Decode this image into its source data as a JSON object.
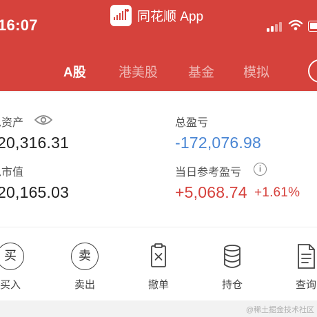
{
  "status_bar": {
    "time": "16:07"
  },
  "app": {
    "name": "同花顺 App"
  },
  "tabs": [
    {
      "label": "A股",
      "active": true
    },
    {
      "label": "港美股",
      "active": false
    },
    {
      "label": "基金",
      "active": false
    },
    {
      "label": "模拟",
      "active": false
    }
  ],
  "account": {
    "total_assets_label": "总资产",
    "total_assets_value": "20,316.31",
    "total_pnl_label": "总盈亏",
    "total_pnl_value": "-172,076.98",
    "market_value_label": "总市值",
    "market_value_value": "20,165.03",
    "daily_pnl_label": "当日参考盈亏",
    "daily_pnl_value": "+5,068.74",
    "daily_pnl_pct": "+1.61%"
  },
  "actions": [
    {
      "label": "买入",
      "glyph": "买",
      "icon": "buy-icon"
    },
    {
      "label": "卖出",
      "glyph": "卖",
      "icon": "sell-icon"
    },
    {
      "label": "撤单",
      "icon": "cancel-order-icon"
    },
    {
      "label": "持仓",
      "icon": "holdings-icon"
    },
    {
      "label": "查询",
      "icon": "query-icon"
    }
  ],
  "watermark": "@稀土掘金技术社区",
  "colors": {
    "header": "#d6423c",
    "loss": "#4a86d4",
    "gain": "#d6413c"
  }
}
